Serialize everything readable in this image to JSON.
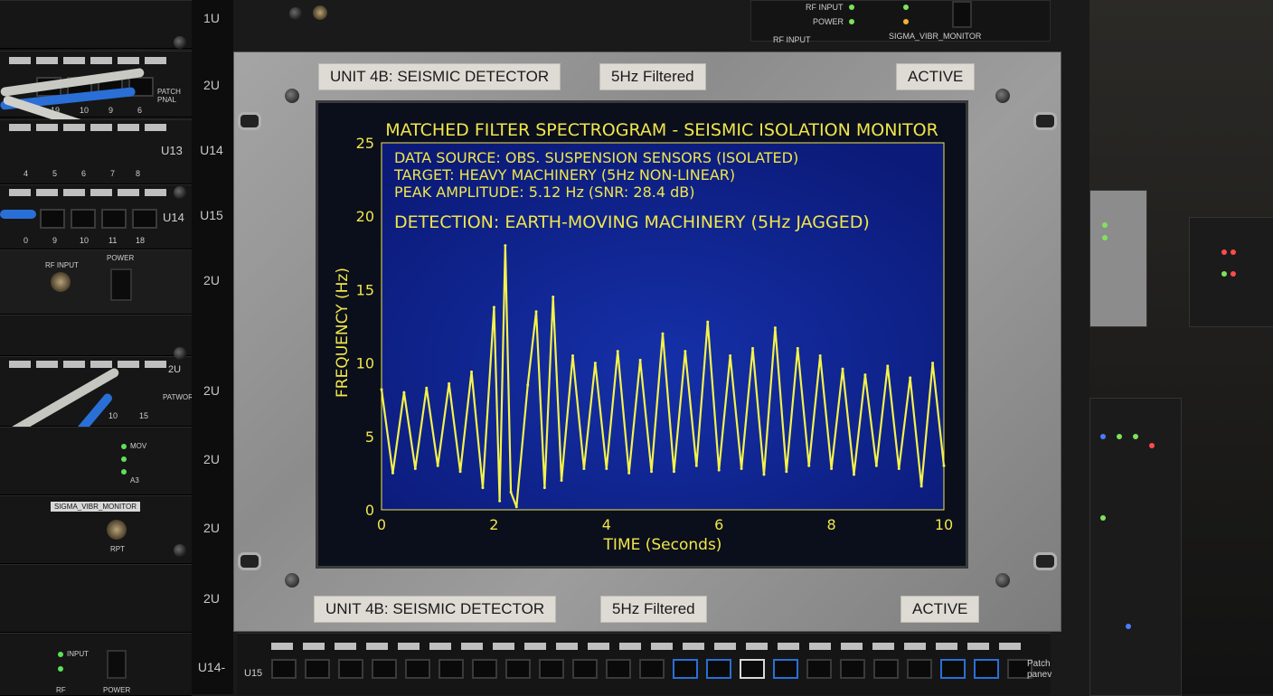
{
  "rack": {
    "unit_labels": [
      "1U",
      "2U",
      "U14",
      "U15",
      "2U",
      "2U",
      "2U",
      "2U",
      "2U",
      "U14-"
    ],
    "left_labels": {
      "patch_panel": "PATCH PNAL",
      "two_u": "2U",
      "u13": "U13",
      "u14": "U14",
      "rf_input": "RF INPUT",
      "power": "POWER",
      "two_u_b": "2U",
      "patwork": "PATWORK",
      "sigma": "SIGMA_VIBR_MONITOR",
      "rpt": "RPT",
      "input": "INPUT",
      "rf": "RF",
      "power_b": "POWER",
      "u15": "U15",
      "mov": "MOV",
      "a3": "A3"
    },
    "port_numbers_1": [
      "19",
      "10",
      "9",
      "6"
    ],
    "port_numbers_2": [
      "4",
      "5",
      "6",
      "7",
      "8"
    ],
    "port_numbers_3": [
      "0",
      "9",
      "10",
      "11",
      "18"
    ],
    "port_numbers_4": [
      "10",
      "15"
    ]
  },
  "top_device": {
    "rf_input": "RF INPUT",
    "power": "POWER",
    "rf_input_b": "RF INPUT",
    "model": "SIGMA_VIBR_MONITOR"
  },
  "bottom_patch": {
    "label": "Patch panev"
  },
  "plates": {
    "top_left": "UNIT 4B: SEISMIC DETECTOR",
    "top_center": "5Hz Filtered",
    "top_right": "ACTIVE",
    "bottom_left": "UNIT 4B: SEISMIC DETECTOR",
    "bottom_center": "5Hz Filtered",
    "bottom_right": "ACTIVE"
  },
  "colors": {
    "plot_bg": "#0e1f86",
    "signal": "#f4f24a",
    "text": "#f0e64a",
    "frame": "#9a9a9a"
  },
  "chart_data": {
    "type": "line",
    "title": "MATCHED FILTER SPECTROGRAM - SEISMIC ISOLATION MONITOR",
    "xlabel": "TIME (Seconds)",
    "ylabel": "FREQUENCY (Hz)",
    "xlim": [
      0,
      10
    ],
    "ylim": [
      0,
      25
    ],
    "xticks": [
      "0",
      "2",
      "4",
      "6",
      "8",
      "10"
    ],
    "yticks": [
      "0",
      "5",
      "10",
      "15",
      "20",
      "25"
    ],
    "annotations": [
      "DATA SOURCE: OBS. SUSPENSION SENSORS (ISOLATED)",
      "TARGET: HEAVY MACHINERY (5Hz NON-LINEAR)",
      "PEAK AMPLITUDE: 5.12 Hz (SNR: 28.4 dB)",
      "DETECTION: EARTH-MOVING MACHINERY (5Hz JAGGED)"
    ],
    "series": [
      {
        "x": [
          0,
          0.2,
          0.4,
          0.6,
          0.8,
          1.0,
          1.2,
          1.4,
          1.6,
          1.8,
          2.0,
          2.1,
          2.2,
          2.3,
          2.4,
          2.6,
          2.75,
          2.9,
          3.05,
          3.2,
          3.4,
          3.6,
          3.8,
          4.0,
          4.2,
          4.4,
          4.6,
          4.8,
          5.0,
          5.2,
          5.4,
          5.6,
          5.8,
          6.0,
          6.2,
          6.4,
          6.6,
          6.8,
          7.0,
          7.2,
          7.4,
          7.6,
          7.8,
          8.0,
          8.2,
          8.4,
          8.6,
          8.8,
          9.0,
          9.2,
          9.4,
          9.6,
          9.8,
          10.0
        ],
        "y": [
          8.2,
          2.5,
          8.0,
          2.8,
          8.3,
          3.0,
          8.6,
          2.6,
          9.4,
          1.5,
          13.8,
          0.6,
          18.0,
          1.2,
          0.2,
          8.5,
          13.5,
          1.5,
          14.5,
          2.0,
          10.5,
          2.8,
          10.0,
          2.8,
          10.8,
          2.5,
          10.2,
          2.6,
          12.0,
          2.6,
          10.8,
          3.0,
          12.8,
          2.7,
          10.5,
          2.8,
          11.0,
          2.4,
          12.4,
          2.6,
          11.0,
          3.0,
          10.5,
          2.8,
          9.6,
          2.4,
          9.2,
          3.0,
          9.8,
          2.8,
          9.0,
          1.6,
          10.0,
          3.0
        ]
      }
    ],
    "grid": false,
    "legend": "none"
  }
}
